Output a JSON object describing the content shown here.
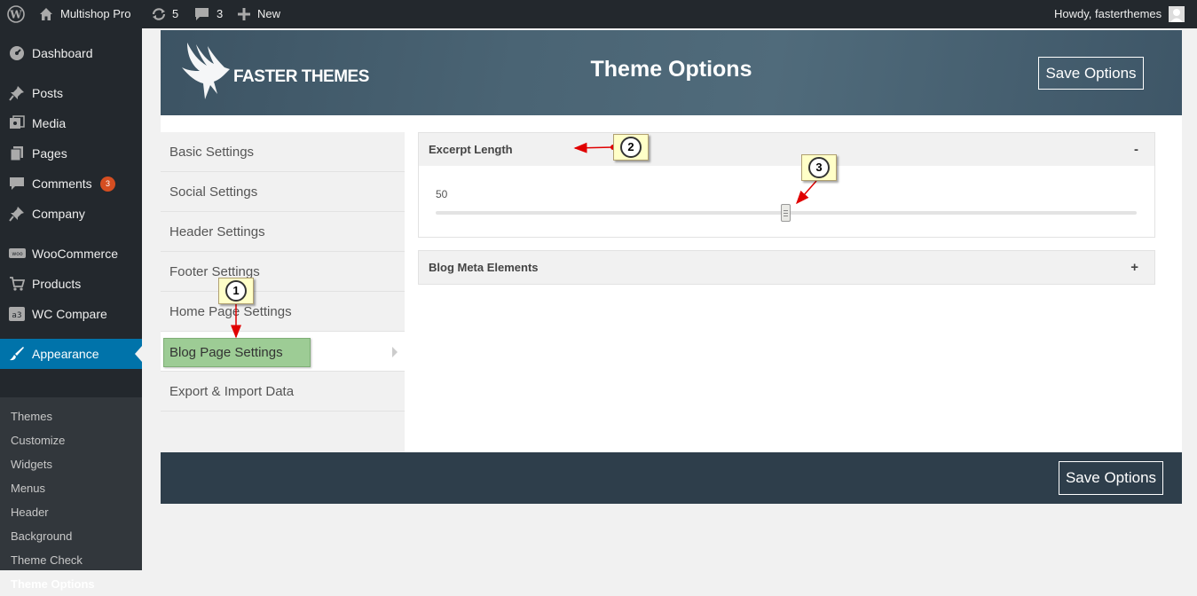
{
  "adminbar": {
    "site_name": "Multishop Pro",
    "updates_count": "5",
    "comments_count": "3",
    "new_label": "New",
    "howdy": "Howdy, fasterthemes"
  },
  "menu": {
    "items": [
      {
        "label": "Dashboard",
        "icon": "dashboard-icon"
      },
      {
        "label": "Posts",
        "icon": "pin-icon"
      },
      {
        "label": "Media",
        "icon": "media-icon"
      },
      {
        "label": "Pages",
        "icon": "pages-icon"
      },
      {
        "label": "Comments",
        "icon": "comment-icon",
        "badge": "3"
      },
      {
        "label": "Company",
        "icon": "pin-icon"
      },
      {
        "label": "WooCommerce",
        "icon": "woo-icon"
      },
      {
        "label": "Products",
        "icon": "cart-icon"
      },
      {
        "label": "WC Compare",
        "icon": "a3-icon"
      },
      {
        "label": "Appearance",
        "icon": "brush-icon"
      }
    ],
    "submenu": [
      "Themes",
      "Customize",
      "Widgets",
      "Menus",
      "Header",
      "Background",
      "Theme Check",
      "Theme Options"
    ]
  },
  "panel": {
    "brand": "FASTER THEMES",
    "title": "Theme Options",
    "save_label": "Save Options",
    "tabs": [
      "Basic Settings",
      "Social Settings",
      "Header Settings",
      "Footer Settings",
      "Home Page Settings",
      "Blog Page Settings",
      "Export & Import Data"
    ],
    "active_tab": "Blog Page Settings",
    "sections": {
      "excerpt": {
        "label": "Excerpt Length",
        "toggle": "-",
        "value": "50",
        "slider_fraction": 0.5
      },
      "meta": {
        "label": "Blog Meta Elements",
        "toggle": "+"
      }
    }
  },
  "annotations": [
    "1",
    "2",
    "3"
  ],
  "colors": {
    "admin_bar": "#23282d",
    "menu_active": "#0073aa",
    "highlight": "#9dcc95",
    "callout": "#ffffc8",
    "arrow": "#e00000"
  }
}
